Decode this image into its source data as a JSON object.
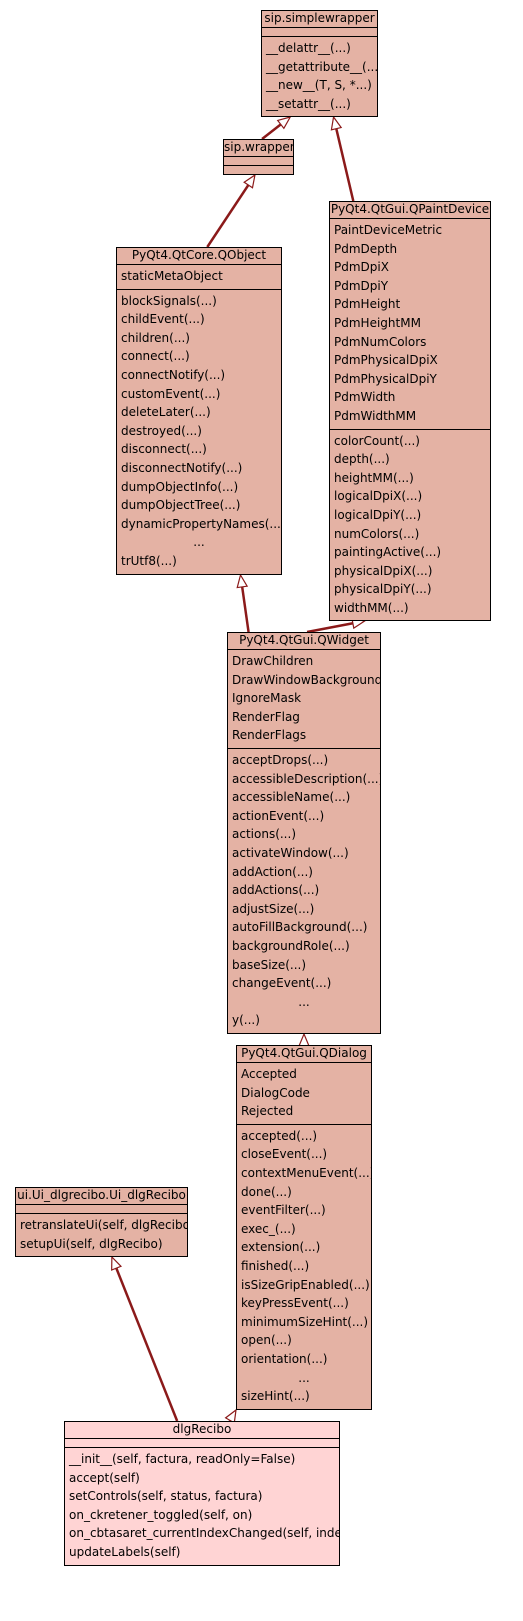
{
  "classes": {
    "simplewrapper": {
      "name": "sip.simplewrapper",
      "attributes": [],
      "methods": [
        "__delattr__(...)",
        "__getattribute__(...)",
        "__new__(T, S, *...)",
        "__setattr__(...)"
      ]
    },
    "wrapper": {
      "name": "sip.wrapper",
      "attributes": [],
      "methods": []
    },
    "qpaintdevice": {
      "name": "PyQt4.QtGui.QPaintDevice",
      "attributes": [
        "PaintDeviceMetric",
        "PdmDepth",
        "PdmDpiX",
        "PdmDpiY",
        "PdmHeight",
        "PdmHeightMM",
        "PdmNumColors",
        "PdmPhysicalDpiX",
        "PdmPhysicalDpiY",
        "PdmWidth",
        "PdmWidthMM"
      ],
      "methods": [
        "colorCount(...)",
        "depth(...)",
        "heightMM(...)",
        "logicalDpiX(...)",
        "logicalDpiY(...)",
        "numColors(...)",
        "paintingActive(...)",
        "physicalDpiX(...)",
        "physicalDpiY(...)",
        "widthMM(...)"
      ]
    },
    "qobject": {
      "name": "PyQt4.QtCore.QObject",
      "attributes": [
        "staticMetaObject"
      ],
      "methods": [
        "blockSignals(...)",
        "childEvent(...)",
        "children(...)",
        "connect(...)",
        "connectNotify(...)",
        "customEvent(...)",
        "deleteLater(...)",
        "destroyed(...)",
        "disconnect(...)",
        "disconnectNotify(...)",
        "dumpObjectInfo(...)",
        "dumpObjectTree(...)",
        "dynamicPropertyNames(...)",
        "...",
        "trUtf8(...)"
      ]
    },
    "qwidget": {
      "name": "PyQt4.QtGui.QWidget",
      "attributes": [
        "DrawChildren",
        "DrawWindowBackground",
        "IgnoreMask",
        "RenderFlag",
        "RenderFlags"
      ],
      "methods": [
        "acceptDrops(...)",
        "accessibleDescription(...)",
        "accessibleName(...)",
        "actionEvent(...)",
        "actions(...)",
        "activateWindow(...)",
        "addAction(...)",
        "addActions(...)",
        "adjustSize(...)",
        "autoFillBackground(...)",
        "backgroundRole(...)",
        "baseSize(...)",
        "changeEvent(...)",
        "...",
        "y(...)"
      ]
    },
    "qdialog": {
      "name": "PyQt4.QtGui.QDialog",
      "attributes": [
        "Accepted",
        "DialogCode",
        "Rejected"
      ],
      "methods": [
        "accepted(...)",
        "closeEvent(...)",
        "contextMenuEvent(...)",
        "done(...)",
        "eventFilter(...)",
        "exec_(...)",
        "extension(...)",
        "finished(...)",
        "isSizeGripEnabled(...)",
        "keyPressEvent(...)",
        "minimumSizeHint(...)",
        "open(...)",
        "orientation(...)",
        "...",
        "sizeHint(...)"
      ]
    },
    "uidlgrecibo": {
      "name": "ui.Ui_dlgrecibo.Ui_dlgRecibo",
      "attributes": [],
      "methods": [
        "retranslateUi(self, dlgRecibo)",
        "setupUi(self, dlgRecibo)"
      ]
    },
    "dlgrecibo": {
      "name": "dlgRecibo",
      "attributes": [],
      "methods": [
        "__init__(self, factura, readOnly=False)",
        "accept(self)",
        "setControls(self, status, factura)",
        "on_ckretener_toggled(self, on)",
        "on_cbtasaret_currentIndexChanged(self, index)",
        "updateLabels(self)"
      ]
    }
  },
  "colors": {
    "node_fill": "#e4b2a4",
    "focus_fill": "#ffd4d4",
    "edge": "#8b1a1a"
  }
}
